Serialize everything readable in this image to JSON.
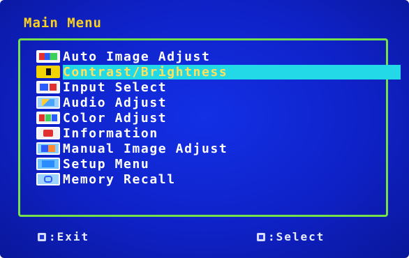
{
  "osd": {
    "title": "Main Menu",
    "items": [
      {
        "label": "Auto Image Adjust",
        "icon": "auto-adjust-icon"
      },
      {
        "label": "Contrast/Brightness",
        "icon": "contrast-brightness-icon"
      },
      {
        "label": "Input Select",
        "icon": "input-select-icon"
      },
      {
        "label": "Audio Adjust",
        "icon": "audio-icon"
      },
      {
        "label": "Color Adjust",
        "icon": "color-icon"
      },
      {
        "label": "Information",
        "icon": "information-icon"
      },
      {
        "label": "Manual Image Adjust",
        "icon": "manual-adjust-icon"
      },
      {
        "label": "Setup Menu",
        "icon": "setup-icon"
      },
      {
        "label": "Memory Recall",
        "icon": "memory-recall-icon"
      }
    ],
    "selected_index": 1,
    "footer": {
      "exit_label": ":Exit",
      "select_label": ":Select"
    }
  },
  "colors": {
    "background": "#1330e6",
    "title": "#ffd21a",
    "frame": "#74e04a",
    "highlight": "#23d9e8",
    "selected_text": "#ffe25a"
  }
}
